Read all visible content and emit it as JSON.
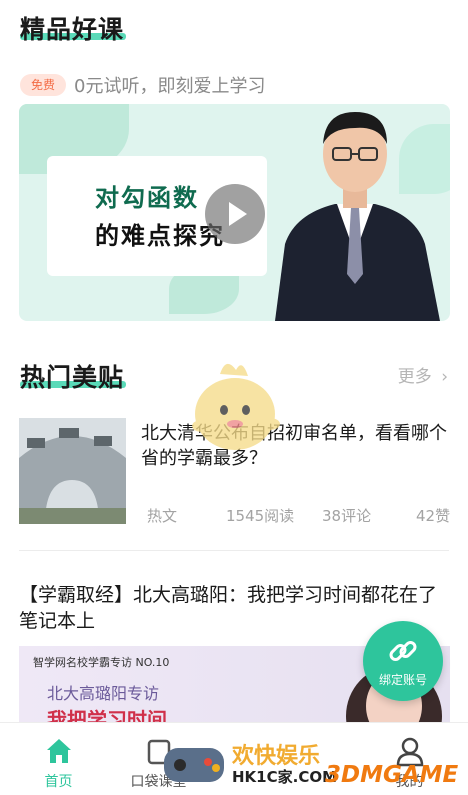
{
  "premium": {
    "title": "精品好课",
    "free_badge": "免费",
    "free_text": "0元试听，即刻爱上学习",
    "banner_line1": "对勾函数",
    "banner_line2": "的难点探究"
  },
  "hot_posts": {
    "title": "热门美贴",
    "more_label": "更多",
    "post1": {
      "title": "北大清华公布自招初审名单，看看哪个省的学霸最多？",
      "tag": "热文",
      "reads": "1545阅读",
      "comments": "38评论",
      "likes": "42赞"
    },
    "post2": {
      "title": "【学霸取经】北大高璐阳：我把学习时间都花在了笔记本上",
      "banner_line1": "智学网名校学霸专访 NO.10",
      "banner_line2": "北大高璐阳专访",
      "banner_line3": "我把学习时间"
    }
  },
  "fab": {
    "label": "绑定账号"
  },
  "nav": {
    "items": [
      {
        "label": "首页",
        "icon": "home-icon"
      },
      {
        "label": "口袋课堂",
        "icon": "pocket-class-icon"
      },
      {
        "label": "",
        "icon": ""
      },
      {
        "label": "我的",
        "icon": "user-icon"
      }
    ]
  },
  "watermark": {
    "line1": "欢快娱乐",
    "line2": "HK1C家.COM",
    "line3": "3DMGAME"
  },
  "colors": {
    "accent": "#2ec59c",
    "underline": "#3dd3ac",
    "badge_bg": "#ffe4dc",
    "badge_text": "#f36c46"
  }
}
